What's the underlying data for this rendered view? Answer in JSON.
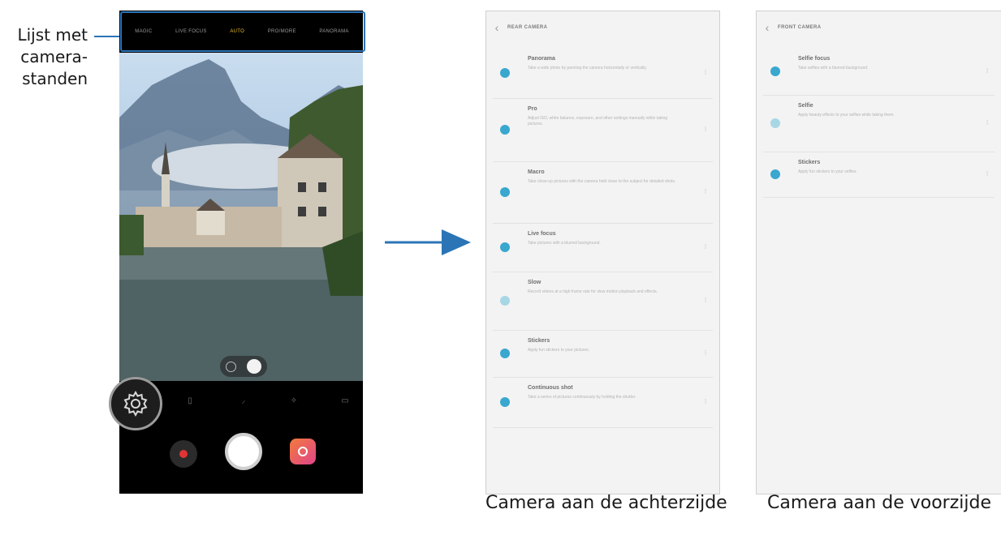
{
  "callout": {
    "line1": "Lijst met",
    "line2": "camera-",
    "line3": "standen"
  },
  "phone": {
    "modes": [
      "MAGIC",
      "LIVE FOCUS",
      "AUTO",
      "PRO/MORE",
      "PANORAMA"
    ],
    "active_mode_index": 2,
    "toolbar_icons": [
      "settings-gear-icon",
      "flash-icon",
      "timer-icon",
      "filter-icon",
      "ratio-icon"
    ],
    "buttons": [
      "record-button",
      "shutter-button",
      "bixby-vision-button"
    ]
  },
  "back_panel": {
    "title": "REAR CAMERA",
    "items": [
      {
        "name": "Panorama",
        "desc": "Take a wide photo by panning the camera horizontally or vertically.",
        "lines": 2
      },
      {
        "name": "Pro",
        "desc": "Adjust ISO, white balance, exposure, and other settings manually while taking pictures.",
        "lines": 3
      },
      {
        "name": "Macro",
        "desc": "Take close-up pictures with the camera held close to the subject for detailed shots.",
        "lines": 3
      },
      {
        "name": "Live focus",
        "desc": "Take pictures with a blurred background.",
        "lines": 2
      },
      {
        "name": "Slow",
        "desc": "Record videos at a high frame rate for slow motion playback and effects.",
        "lines": 3
      },
      {
        "name": "Stickers",
        "desc": "Apply fun stickers to your pictures.",
        "lines": 1
      },
      {
        "name": "Continuous shot",
        "desc": "Take a series of pictures continuously by holding the shutter.",
        "lines": 2
      }
    ]
  },
  "front_panel": {
    "title": "FRONT CAMERA",
    "items": [
      {
        "name": "Selfie focus",
        "desc": "Take selfies with a blurred background.",
        "lines": 1
      },
      {
        "name": "Selfie",
        "desc": "Apply beauty effects to your selfies while taking them.",
        "lines": 2
      },
      {
        "name": "Stickers",
        "desc": "Apply fun stickers to your selfies.",
        "lines": 1
      }
    ]
  },
  "captions": {
    "back": "Camera aan de achterzijde",
    "front": "Camera aan de voorzijde"
  },
  "colors": {
    "accent_blue": "#2b74b6",
    "item_dot": "#3aa7cf",
    "active_mode": "#e8c02a"
  }
}
